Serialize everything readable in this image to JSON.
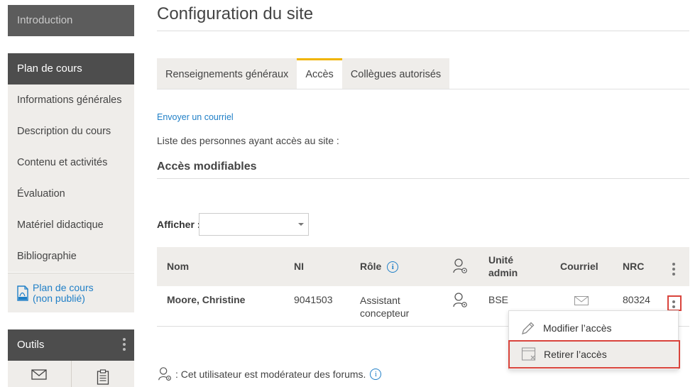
{
  "sidebar": {
    "intro_label": "Introduction",
    "plan_title": "Plan de cours",
    "plan_items": [
      {
        "label": "Informations générales"
      },
      {
        "label": "Description du cours"
      },
      {
        "label": "Contenu et activités"
      },
      {
        "label": "Évaluation"
      },
      {
        "label": "Matériel didactique"
      },
      {
        "label": "Bibliographie"
      }
    ],
    "pdf_link_line1": "Plan de cours",
    "pdf_link_line2": "(non publié)",
    "tools_title": "Outils"
  },
  "page": {
    "title": "Configuration du site"
  },
  "tabs": [
    {
      "label": "Renseignements généraux",
      "active": false
    },
    {
      "label": "Accès",
      "active": true
    },
    {
      "label": "Collègues autorisés",
      "active": false
    }
  ],
  "content": {
    "send_mail_link": "Envoyer un courriel",
    "list_caption": "Liste des personnes ayant accès au site :",
    "section_title": "Accès modifiables",
    "show_label": "Afficher :",
    "show_value": ""
  },
  "table": {
    "headers": {
      "name": "Nom",
      "ni": "NI",
      "role": "Rôle",
      "unit_line1": "Unité",
      "unit_line2": "admin",
      "email": "Courriel",
      "nrc": "NRC"
    },
    "rows": [
      {
        "name": "Moore, Christine",
        "ni": "9041503",
        "role_line1": "Assistant",
        "role_line2": "concepteur",
        "unit": "BSE",
        "nrc": "80324"
      }
    ]
  },
  "menu": {
    "edit_label": "Modifier l’accès",
    "remove_label": "Retirer l’accès"
  },
  "footnote": {
    "text": ": Cet utilisateur est modérateur des forums."
  },
  "colors": {
    "accent_tab": "#f0b400",
    "link_blue": "#1f7fc7",
    "highlight_red": "#d9443c",
    "sidebar_dark": "#4d4d4d",
    "sidebar_light": "#efedea"
  }
}
